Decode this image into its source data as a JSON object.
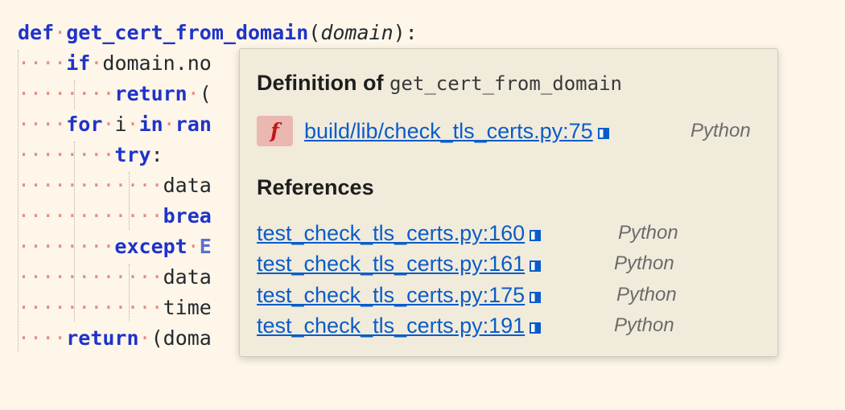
{
  "code": {
    "line1": {
      "kw": "def",
      "name": "get_cert_from_domain",
      "open": "(",
      "param": "domain",
      "close": "):"
    },
    "line2": {
      "kw": "if",
      "rest": "domain.no"
    },
    "line3": {
      "kw": "return",
      "rest": "("
    },
    "line4": {
      "kw1": "for",
      "var": "i",
      "kw2": "in",
      "rest": "ran"
    },
    "line5": {
      "kw": "try",
      "rest": ":"
    },
    "line6": {
      "rest": "data"
    },
    "line7": {
      "kw": "brea"
    },
    "line8": {
      "kw": "except",
      "cls": "E"
    },
    "line9": {
      "rest": "data"
    },
    "line10": {
      "rest": "time"
    },
    "line11": {
      "kw": "return",
      "rest": "(doma"
    }
  },
  "popup": {
    "definition_label": "Definition of",
    "symbol": "get_cert_from_domain",
    "kind_badge": "f",
    "definition": {
      "path": "build/lib/check_tls_certs.py:75",
      "language": "Python"
    },
    "references_label": "References",
    "references": [
      {
        "path": "test_check_tls_certs.py:160",
        "language": "Python"
      },
      {
        "path": "test_check_tls_certs.py:161",
        "language": "Python"
      },
      {
        "path": "test_check_tls_certs.py:175",
        "language": "Python"
      },
      {
        "path": "test_check_tls_certs.py:191",
        "language": "Python"
      }
    ]
  },
  "colors": {
    "keyword": "#1f33c9",
    "link": "#0a5cc8",
    "whitespace_dot": "#e58b82",
    "background": "#fdf6e9"
  }
}
